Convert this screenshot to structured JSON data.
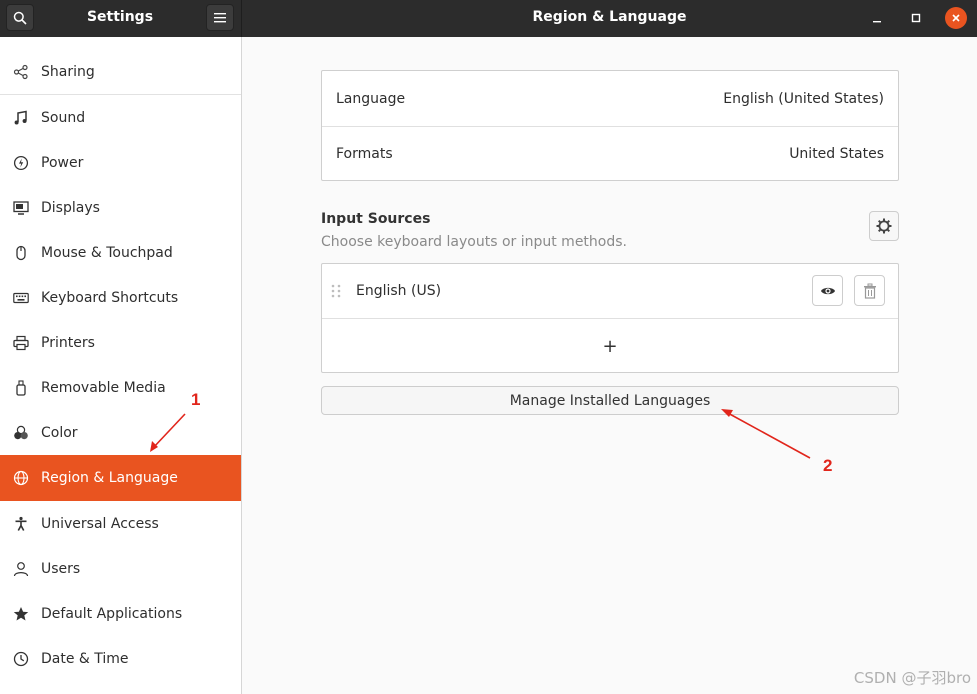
{
  "header": {
    "app_title": "Settings",
    "page_title": "Region & Language"
  },
  "sidebar": {
    "items": [
      {
        "label": "Sharing",
        "icon": "share-icon"
      },
      {
        "label": "Sound",
        "icon": "music-note-icon"
      },
      {
        "label": "Power",
        "icon": "power-icon"
      },
      {
        "label": "Displays",
        "icon": "display-icon"
      },
      {
        "label": "Mouse & Touchpad",
        "icon": "mouse-icon"
      },
      {
        "label": "Keyboard Shortcuts",
        "icon": "keyboard-icon"
      },
      {
        "label": "Printers",
        "icon": "printer-icon"
      },
      {
        "label": "Removable Media",
        "icon": "usb-drive-icon"
      },
      {
        "label": "Color",
        "icon": "color-icon"
      },
      {
        "label": "Region & Language",
        "icon": "globe-icon",
        "active": true
      },
      {
        "label": "Universal Access",
        "icon": "accessibility-icon"
      },
      {
        "label": "Users",
        "icon": "user-icon"
      },
      {
        "label": "Default Applications",
        "icon": "star-icon"
      },
      {
        "label": "Date & Time",
        "icon": "clock-icon"
      }
    ]
  },
  "region": {
    "language_label": "Language",
    "language_value": "English (United States)",
    "formats_label": "Formats",
    "formats_value": "United States"
  },
  "input_sources": {
    "title": "Input Sources",
    "subtitle": "Choose keyboard layouts or input methods.",
    "items": [
      {
        "label": "English (US)"
      }
    ],
    "add_label": "+"
  },
  "manage_button": "Manage Installed Languages",
  "annotations": {
    "one": "1",
    "two": "2"
  },
  "watermark": "CSDN @子羽bro",
  "colors": {
    "accent": "#e95420",
    "headerbar": "#2c2c2c",
    "annotation": "#e1251b"
  }
}
